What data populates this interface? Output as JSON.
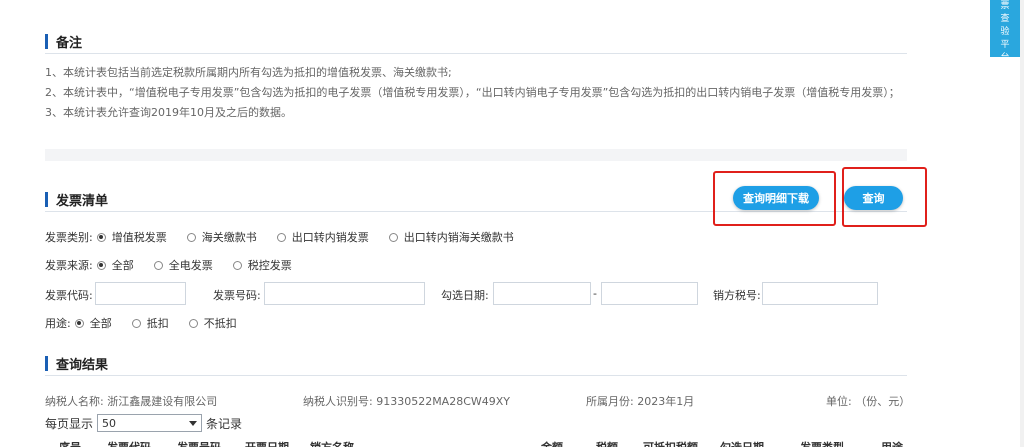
{
  "notes": {
    "title": "备注",
    "items": [
      "1、本统计表包括当前选定税款所属期内所有勾选为抵扣的增值税发票、海关缴款书;",
      "2、本统计表中，“增值税电子专用发票”包含勾选为抵扣的电子发票（增值税专用发票），“出口转内销电子专用发票”包含勾选为抵扣的出口转内销电子发票（增值税专用发票）；",
      "3、本统计表允许查询2019年10月及之后的数据。"
    ]
  },
  "invoice_list": {
    "title": "发票清单",
    "download_button": "查询明细下载",
    "query_button": "查询",
    "type": {
      "label": "发票类别:",
      "options": [
        "增值税发票",
        "海关缴款书",
        "出口转内销发票",
        "出口转内销海关缴款书"
      ],
      "selected": "增值税发票"
    },
    "source": {
      "label": "发票来源:",
      "options": [
        "全部",
        "全电发票",
        "税控发票"
      ],
      "selected": "全部"
    },
    "fields": {
      "code_label": "发票代码:",
      "number_label": "发票号码:",
      "date_label": "勾选日期:",
      "date_separator": "-",
      "seller_tax_label": "销方税号:"
    },
    "usage": {
      "label": "用途:",
      "options": [
        "全部",
        "抵扣",
        "不抵扣"
      ],
      "selected": "全部"
    }
  },
  "results": {
    "title": "查询结果",
    "taxpayer_name": "纳税人名称: 浙江鑫晟建设有限公司",
    "taxpayer_id": "纳税人识别号: 91330522MA28CW49XY",
    "month": "所属月份: 2023年1月",
    "unit": "单位: （份、元）",
    "pager": {
      "prefix": "每页显示",
      "value": "50",
      "suffix": "条记录"
    },
    "columns": [
      "序号",
      "发票代码",
      "发票号码",
      "开票日期",
      "销方名称",
      "金额",
      "税额",
      "可抵扣税额",
      "勾选日期",
      "发票类型",
      "用途"
    ]
  },
  "side_tab": {
    "chars": [
      "票",
      "查",
      "验",
      "平",
      "台"
    ]
  }
}
